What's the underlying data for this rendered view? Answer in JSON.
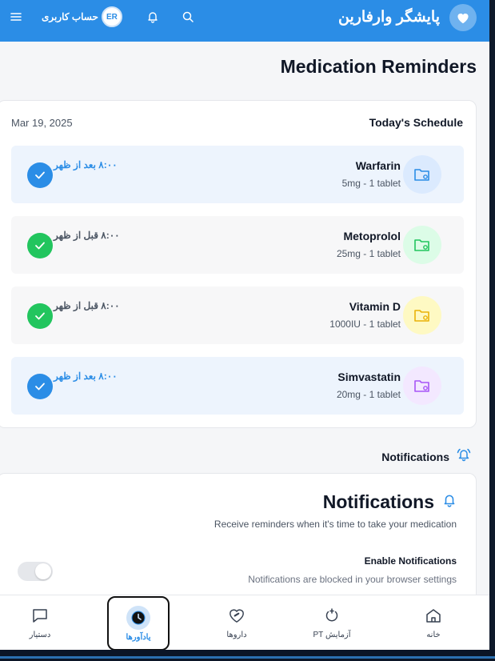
{
  "header": {
    "brand_title": "پایشگر وارفارین",
    "account_label": "حساب کاربری",
    "avatar_initials": "ER"
  },
  "page": {
    "title": "Medication Reminders"
  },
  "schedule": {
    "title": "Today's Schedule",
    "date": "Mar 19, 2025",
    "items": [
      {
        "name": "Warfarin",
        "dose": "5mg - 1 tablet",
        "time": "۸:۰۰ بعد از ظهر",
        "accent": "#2b8de6",
        "icon": "folder-gear-icon"
      },
      {
        "name": "Metoprolol",
        "dose": "25mg - 1 tablet",
        "time": "۸:۰۰ قبل از ظهر",
        "accent": "#22c55e",
        "icon": "folder-gear-icon"
      },
      {
        "name": "Vitamin D",
        "dose": "1000IU - 1 tablet",
        "time": "۸:۰۰ قبل از ظهر",
        "accent": "#eab308",
        "icon": "folder-gear-icon"
      },
      {
        "name": "Simvastatin",
        "dose": "20mg - 1 tablet",
        "time": "۸:۰۰ بعد از ظهر",
        "accent": "#a855f7",
        "icon": "folder-gear-icon"
      }
    ]
  },
  "notifications": {
    "section_label": "Notifications",
    "title": "Notifications",
    "description": "Receive reminders when it's time to take your medication",
    "enable_title": "Enable Notifications",
    "enable_description": "Notifications are blocked in your browser settings",
    "enabled": false
  },
  "bottom_nav": {
    "items": [
      {
        "label": "دستیار",
        "icon": "chat-icon"
      },
      {
        "label": "یادآورها",
        "icon": "clock-icon",
        "active": true
      },
      {
        "label": "داروها",
        "icon": "heart-pill-icon"
      },
      {
        "label": "آزمایش PT",
        "icon": "test-icon"
      },
      {
        "label": "خانه",
        "icon": "home-icon"
      }
    ]
  },
  "colors": {
    "primary": "#2b8de6",
    "success": "#22c55e"
  }
}
